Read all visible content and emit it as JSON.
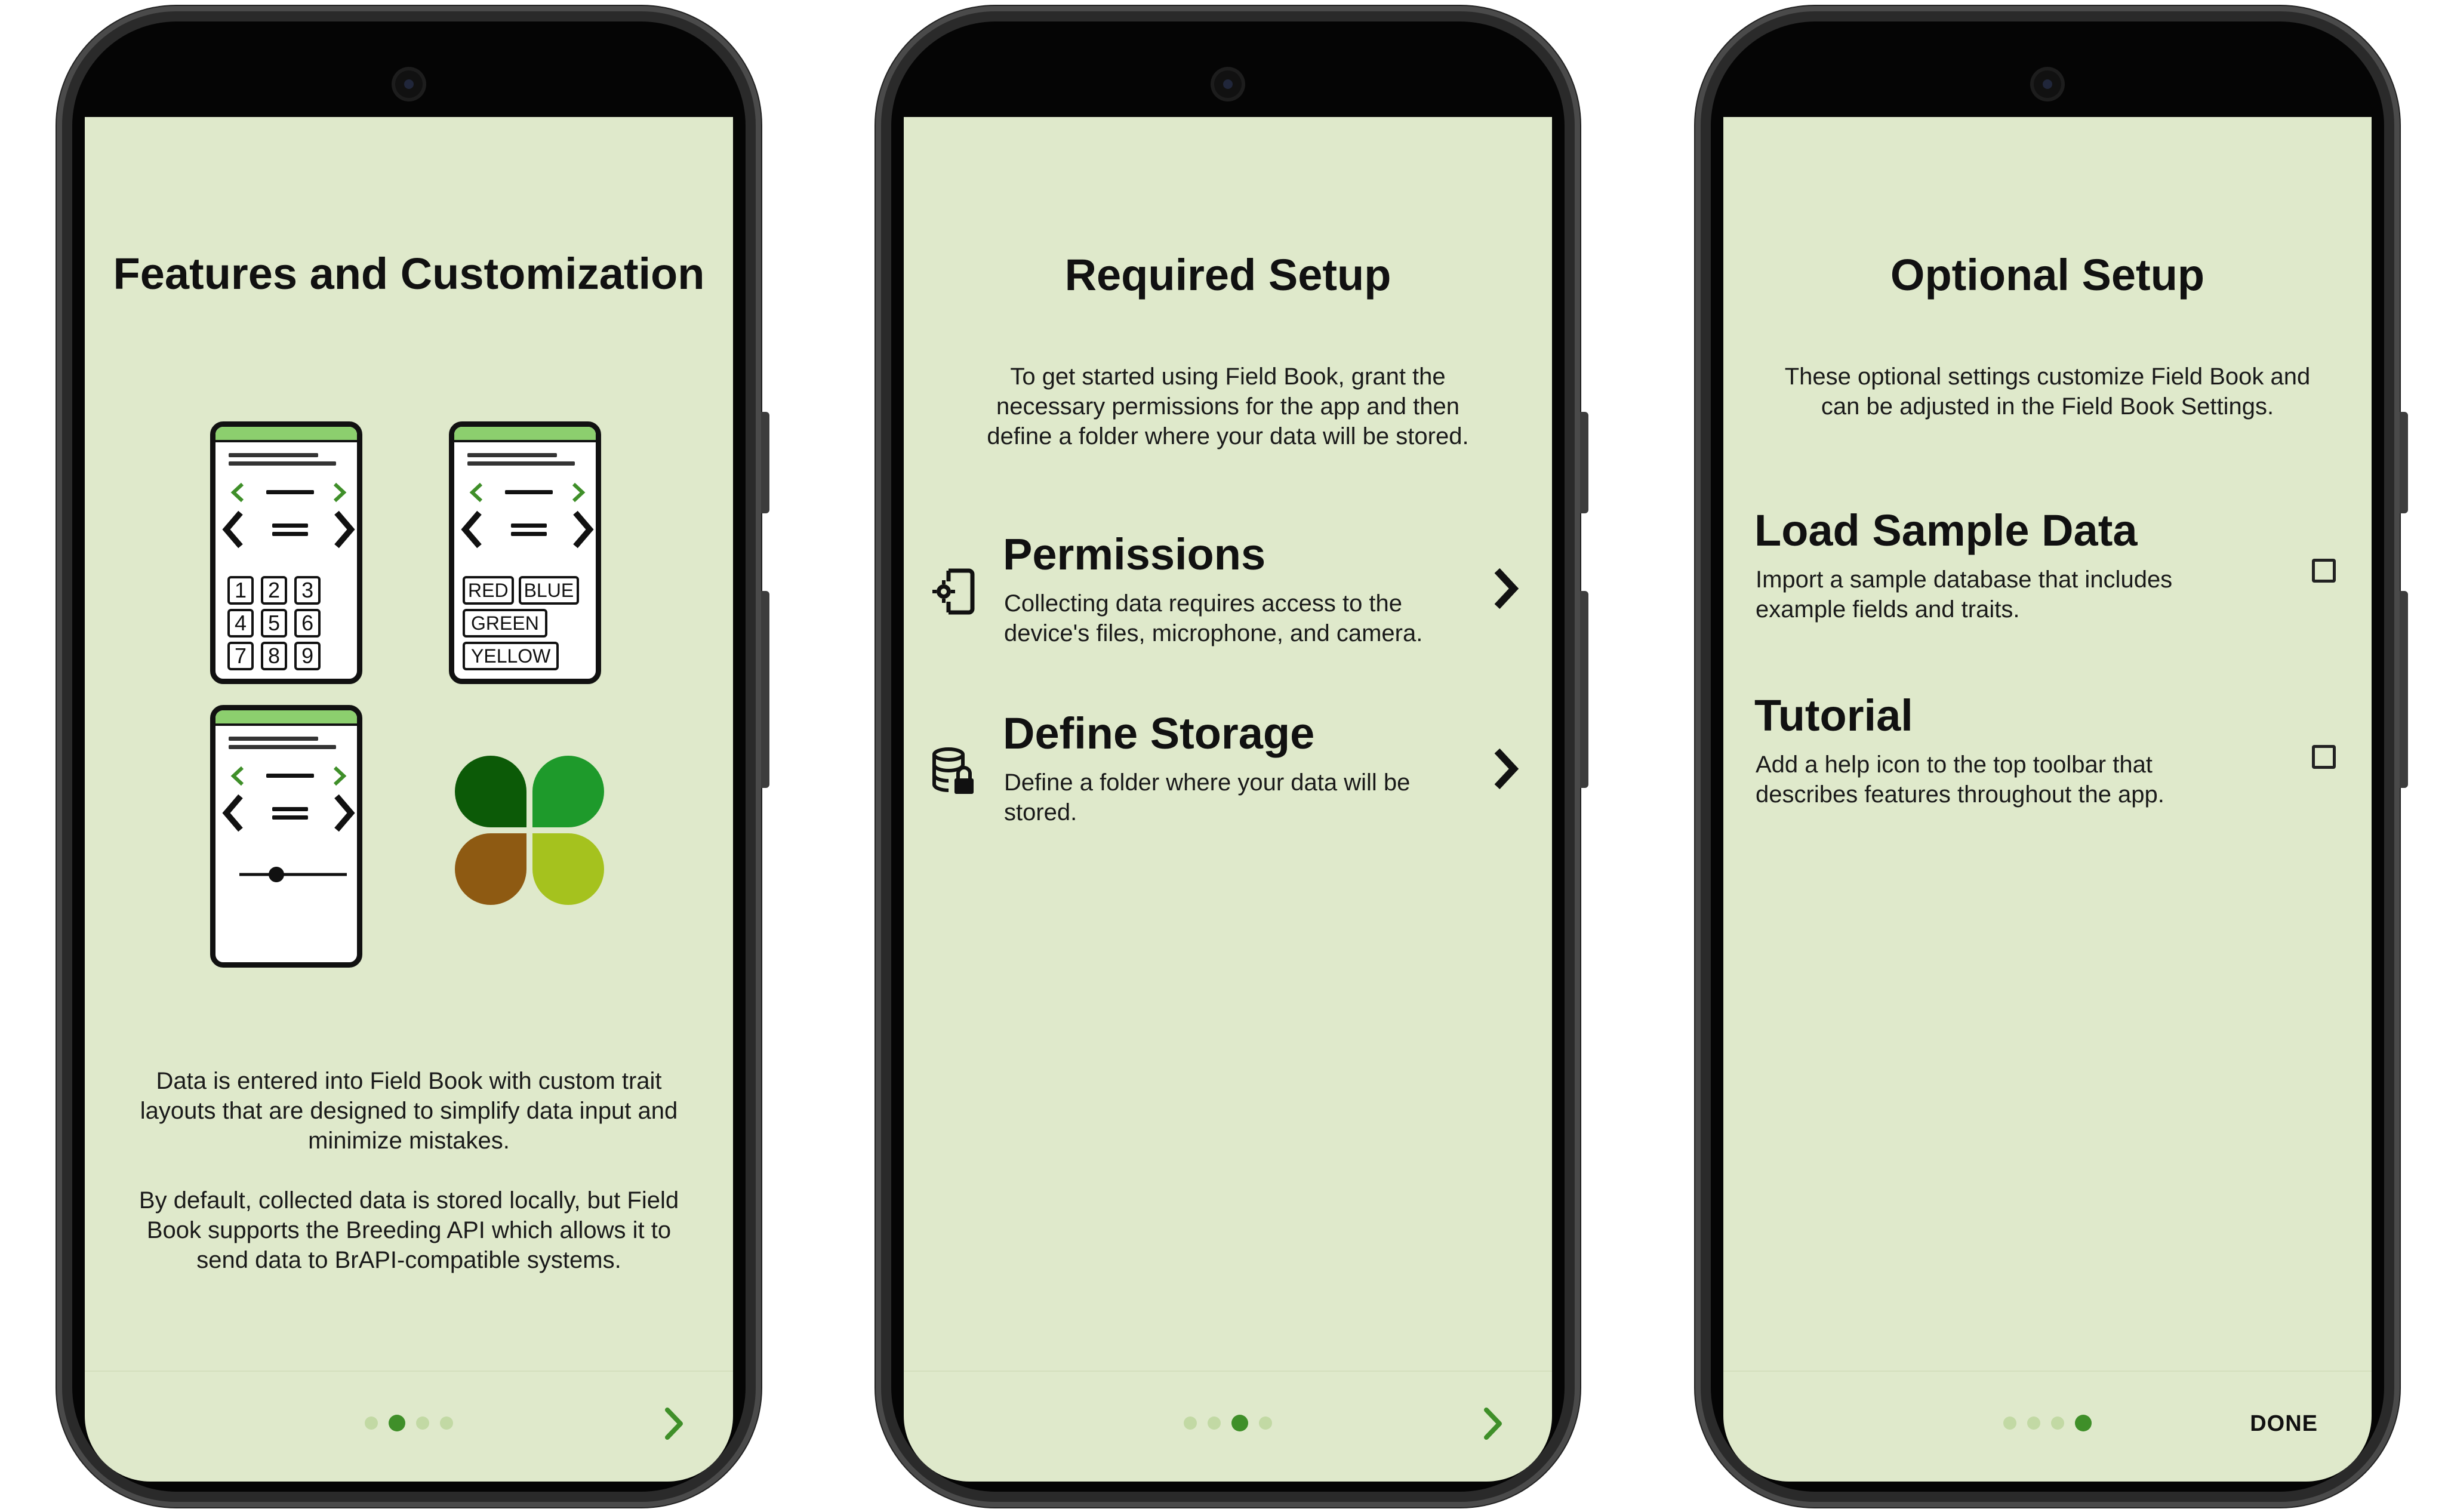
{
  "screens": [
    {
      "title": "Features and Customization",
      "illustration": {
        "keypad": [
          "1",
          "2",
          "3",
          "4",
          "5",
          "6",
          "7",
          "8",
          "9"
        ],
        "color_chips": [
          "RED",
          "BLUE",
          "GREEN",
          "YELLOW"
        ],
        "logo_colors": [
          "#0c5a07",
          "#1e9a2b",
          "#8e5a12",
          "#a5c21e"
        ]
      },
      "paragraph_1": "Data is entered into Field Book with custom trait layouts that are designed to simplify data input and minimize mistakes.",
      "paragraph_2": "By default, collected data is stored locally, but Field Book supports the Breeding API which allows it to send data to BrAPI-compatible systems.",
      "pager": {
        "total": 4,
        "active": 2
      },
      "footer_action": "next-arrow"
    },
    {
      "title": "Required Setup",
      "intro": "To get started using Field Book, grant the necessary permissions for the app and then define a folder where your data will be stored.",
      "items": [
        {
          "title": "Permissions",
          "description": "Collecting data requires access to the device's files, microphone, and camera.",
          "icon": "phone-settings-icon"
        },
        {
          "title": "Define Storage",
          "description": "Define a folder where your data will be stored.",
          "icon": "database-lock-icon"
        }
      ],
      "pager": {
        "total": 4,
        "active": 3
      },
      "footer_action": "next-arrow"
    },
    {
      "title": "Optional Setup",
      "intro": "These optional settings customize Field Book and can be adjusted in the Field Book Settings.",
      "items": [
        {
          "title": "Load Sample Data",
          "description": "Import a sample database that includes example fields and traits.",
          "checked": false
        },
        {
          "title": "Tutorial",
          "description": "Add a help icon to the top toolbar that describes features throughout the app.",
          "checked": false
        }
      ],
      "pager": {
        "total": 4,
        "active": 4
      },
      "done_label": "DONE"
    }
  ],
  "colors": {
    "screen_background": "#dfe9cb",
    "accent": "#3f8f29",
    "dot_inactive": "#c2d9a4"
  }
}
